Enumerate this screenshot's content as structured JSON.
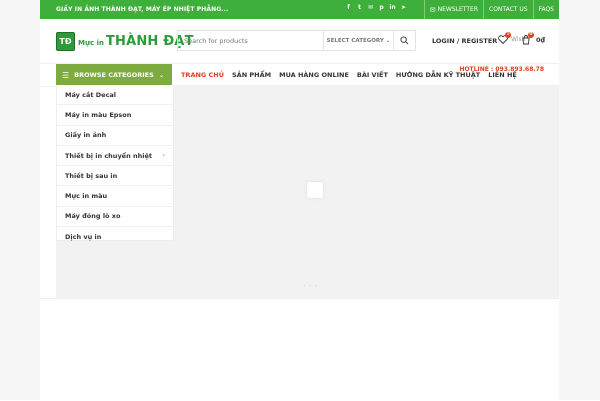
{
  "topbar": {
    "promo": "GIẤY IN ẢNH THÀNH ĐẠT, MÁY ÉP NHIỆT PHẲNG...",
    "links": [
      "NEWSLETTER",
      "CONTACT US",
      "FAQS"
    ]
  },
  "header": {
    "logo_mark": "TĐ",
    "logo_small": "Mực in",
    "logo_big": "THÀNH ĐẠT",
    "search_placeholder": "Search for products",
    "select_category": "SELECT CATEGORY",
    "login": "LOGIN / REGISTER",
    "wishlist_label": "Wish",
    "wishlist_count": "0",
    "cart_count": "0",
    "cart_total": "0₫"
  },
  "nav": {
    "browse": "BROWSE CATEGORIES",
    "items": [
      "TRANG CHỦ",
      "SẢN PHẨM",
      "MUA HÀNG ONLINE",
      "BÀI VIẾT",
      "HƯỚNG DẪN KỸ THUẬT",
      "LIÊN HỆ"
    ],
    "hotline": "HOTLINE : 093.893.68.78"
  },
  "categories": [
    "Máy cắt Decal",
    "Máy in màu Epson",
    "Giấy in ảnh",
    "Thiết bị in chuyển nhiệt",
    "Thiết bị sau in",
    "Mực in màu",
    "Máy đóng lò xo",
    "Dịch vụ in"
  ],
  "icons": [
    "facebook-icon",
    "twitter-icon",
    "email-icon",
    "pinterest-icon",
    "linkedin-icon",
    "telegram-icon",
    "mail-icon",
    "search-icon",
    "heart-icon",
    "cart-icon",
    "menu-icon",
    "chevron-down-icon",
    "chevron-right-icon"
  ],
  "colors": {
    "brand_green": "#3eaf3a",
    "browse_green": "#7dab3f",
    "accent_red": "#e2401c"
  }
}
